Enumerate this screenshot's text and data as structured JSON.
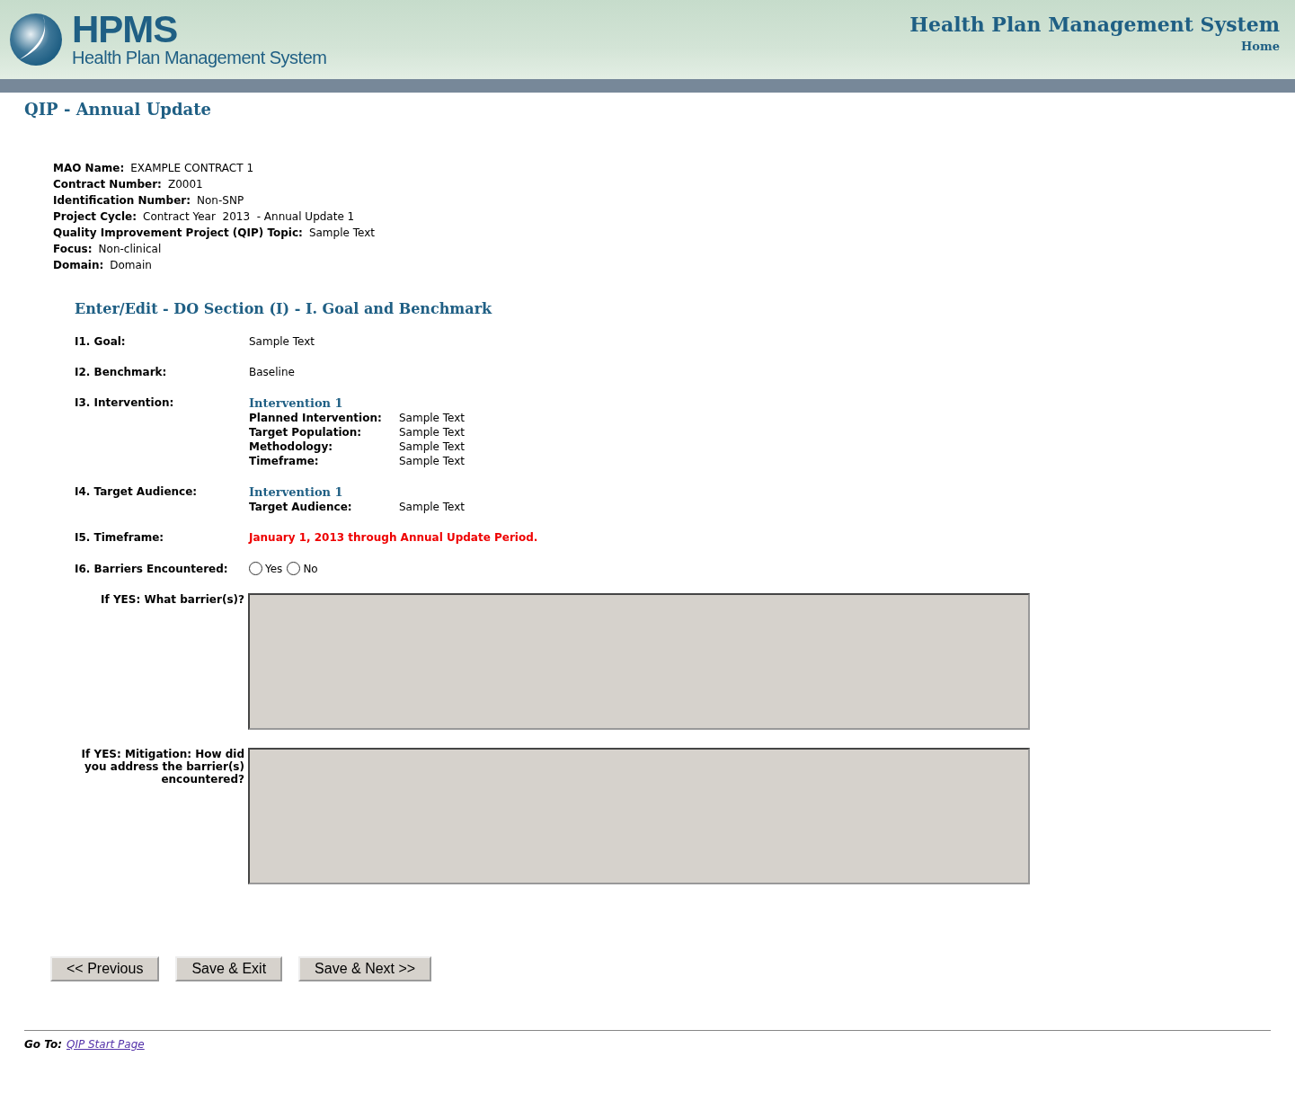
{
  "header": {
    "logo_acronym": "HPMS",
    "logo_subtitle": "Health Plan Management System",
    "system_title": "Health Plan Management System",
    "home_link": "Home"
  },
  "page_title": "QIP - Annual Update",
  "info": [
    {
      "label": "MAO Name:",
      "value": "EXAMPLE CONTRACT 1"
    },
    {
      "label": "Contract Number:",
      "value": "Z0001"
    },
    {
      "label": "Identification Number:",
      "value": "Non-SNP"
    },
    {
      "label": "Project Cycle:",
      "value": "Contract Year  2013  - Annual Update 1"
    },
    {
      "label": "Quality Improvement Project (QIP) Topic:",
      "value": "Sample Text"
    },
    {
      "label": "Focus:",
      "value": "Non-clinical"
    },
    {
      "label": "Domain:",
      "value": "Domain"
    }
  ],
  "section_title": "Enter/Edit - DO Section (I) - I. Goal and Benchmark",
  "fields": [
    {
      "kind": "text",
      "label": "I1. Goal:",
      "value": "Sample Text"
    },
    {
      "kind": "text",
      "label": "I2. Benchmark:",
      "value": "Baseline"
    },
    {
      "kind": "intervention",
      "label": "I3. Intervention:",
      "heading": "Intervention 1",
      "rows": [
        {
          "label": "Planned Intervention:",
          "value": "Sample Text"
        },
        {
          "label": "Target Population:",
          "value": "Sample Text"
        },
        {
          "label": "Methodology:",
          "value": "Sample Text"
        },
        {
          "label": "Timeframe:",
          "value": "Sample Text"
        }
      ]
    },
    {
      "kind": "intervention",
      "label": "I4. Target Audience:",
      "heading": "Intervention 1",
      "rows": [
        {
          "label": "Target Audience:",
          "value": "Sample Text"
        }
      ]
    },
    {
      "kind": "alert",
      "label": "I5. Timeframe:",
      "value": "January 1, 2013 through Annual Update Period."
    },
    {
      "kind": "radio",
      "label": "I6. Barriers Encountered:",
      "options": [
        {
          "label": "Yes",
          "selected": false
        },
        {
          "label": "No",
          "selected": false
        }
      ]
    }
  ],
  "textareas": [
    {
      "label": "If YES: What barrier(s)?"
    },
    {
      "label": "If YES: Mitigation: How did you address the barrier(s) encountered?"
    }
  ],
  "buttons": [
    "<< Previous",
    "Save & Exit",
    "Save & Next >>"
  ],
  "footer": {
    "goto_label": "Go To:",
    "link": "QIP Start Page"
  }
}
